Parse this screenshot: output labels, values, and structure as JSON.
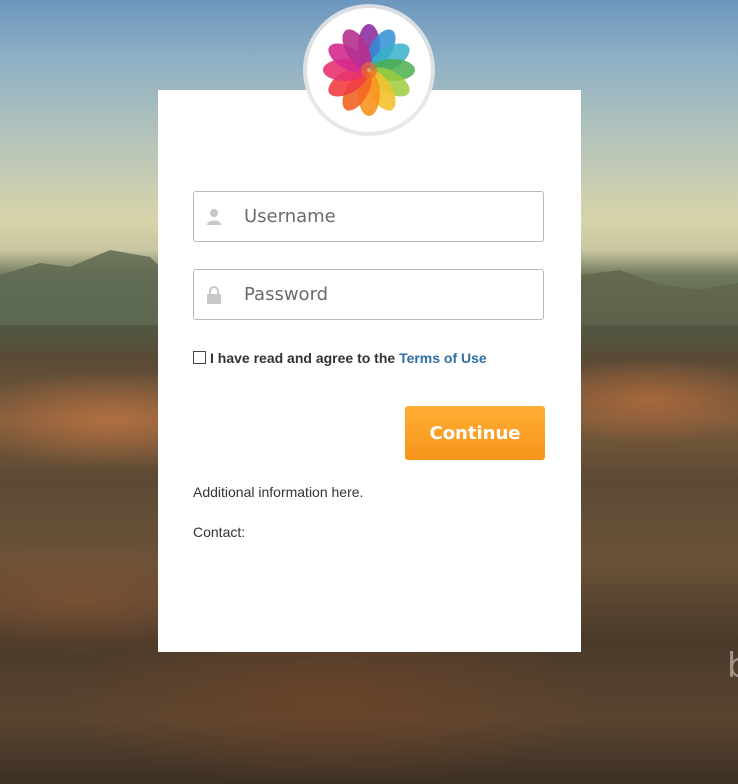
{
  "logo": {
    "icon": "flower-petals-icon"
  },
  "form": {
    "username": {
      "placeholder": "Username",
      "value": "",
      "icon": "user-icon"
    },
    "password": {
      "placeholder": "Password",
      "value": "",
      "icon": "lock-icon"
    },
    "agree": {
      "checked": false,
      "text": "I have read and agree to the",
      "link_text": "Terms of Use"
    },
    "continue_label": "Continue"
  },
  "info": {
    "additional": "Additional information here.",
    "contact": "Contact:"
  },
  "watermark": {
    "glyph": "b"
  },
  "colors": {
    "accent": "#f7951a",
    "link": "#2e6fa7",
    "text": "#333333",
    "field_border": "#b9b9b9"
  }
}
